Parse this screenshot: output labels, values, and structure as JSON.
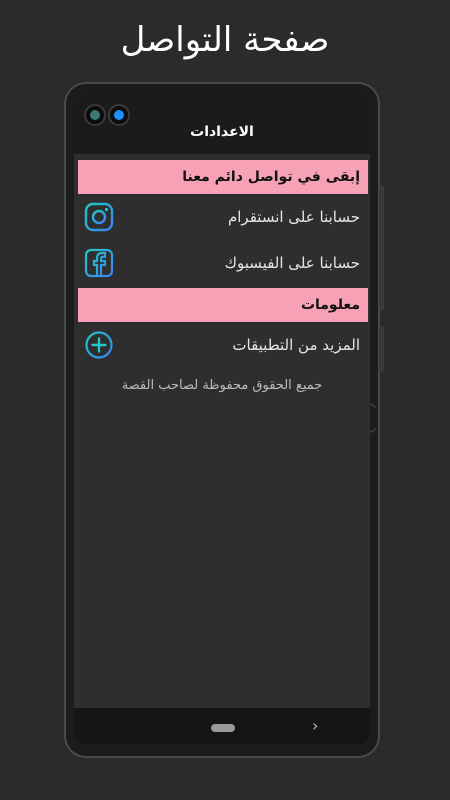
{
  "page_title": "صفحة التواصل",
  "app_bar": {
    "title": "الاعدادات"
  },
  "sections": [
    {
      "header": "إبقى في تواصل دائم معنا",
      "items": [
        {
          "label": "حسابنا على انستقرام",
          "icon": "instagram-icon"
        },
        {
          "label": "حسابنا على الفيسبوك",
          "icon": "facebook-icon"
        }
      ]
    },
    {
      "header": "معلومات",
      "items": [
        {
          "label": "المزيد من التطبيقات",
          "icon": "plus-circle-icon"
        }
      ]
    }
  ],
  "credits": "جميع الحقوق محفوظة لصاحب القصة",
  "colors": {
    "section_header_bg": "#f7a1b7",
    "icon_gradient_start": "#22c7c7",
    "icon_gradient_end": "#3b82f6",
    "screen_bg": "#2e2e2e"
  },
  "nav_bar": {
    "home": "home-pill",
    "back": "chevron-right-icon"
  }
}
